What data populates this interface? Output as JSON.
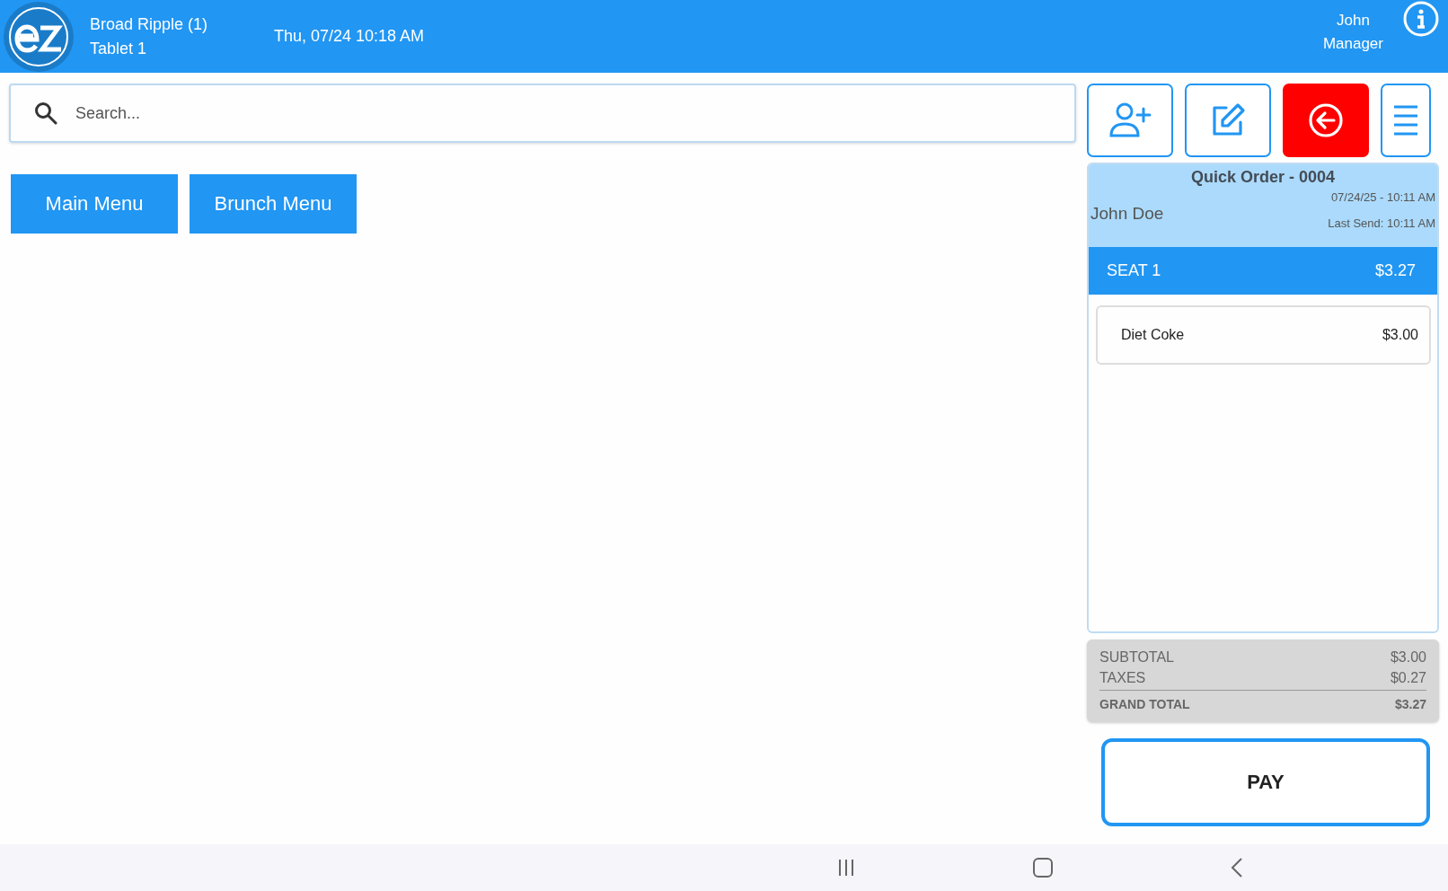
{
  "header": {
    "location": "Broad Ripple (1)",
    "device": "Tablet 1",
    "datetime": "Thu, 07/24 10:18 AM",
    "user_name": "John",
    "user_role": "Manager"
  },
  "search": {
    "placeholder": "Search..."
  },
  "menus": [
    {
      "label": "Main Menu"
    },
    {
      "label": "Brunch Menu"
    }
  ],
  "actions": [
    {
      "kind": "add-customer"
    },
    {
      "kind": "edit"
    },
    {
      "kind": "back"
    },
    {
      "kind": "menu"
    }
  ],
  "order": {
    "title": "Quick Order - 0004",
    "customer": "John Doe",
    "created": "07/24/25 - 10:11 AM",
    "last_send": "Last Send: 10:11 AM",
    "seats": [
      {
        "label": "SEAT 1",
        "total": "$3.27",
        "selected": true,
        "items": [
          {
            "name": "Diet Coke",
            "price": "$3.00"
          }
        ]
      }
    ]
  },
  "totals": [
    {
      "label": "SUBTOTAL",
      "value": "$3.00",
      "kind": "line"
    },
    {
      "label": "TAXES",
      "value": "$0.27",
      "kind": "line"
    },
    {
      "label": "GRAND TOTAL",
      "value": "$3.27",
      "kind": "grand"
    }
  ],
  "pay": {
    "label": "PAY"
  }
}
